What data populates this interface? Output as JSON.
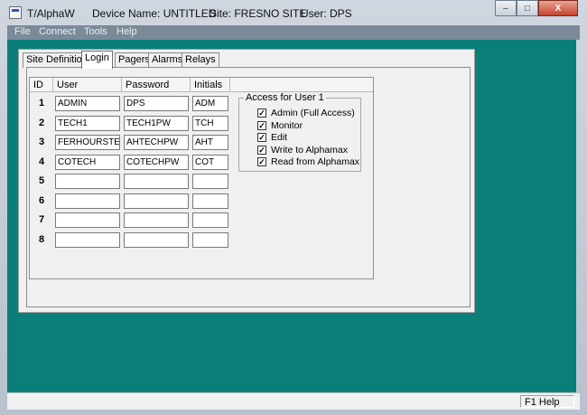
{
  "titlebar": {
    "app": "T/AlphaW",
    "device": "Device Name: UNTITLED",
    "site": "Site: FRESNO SITE",
    "user": "User: DPS",
    "controls": {
      "minimize": "–",
      "maximize": "□",
      "close": "X"
    }
  },
  "menu": [
    "File",
    "Connect",
    "Tools",
    "Help"
  ],
  "tabs": [
    "Site Definition",
    "Login",
    "Pagers",
    "Alarms",
    "Relays"
  ],
  "active_tab": "Login",
  "grid": {
    "headers": [
      "ID",
      "User",
      "Password",
      "Initials"
    ],
    "rows": [
      {
        "id": "1",
        "user": "ADMIN",
        "password": "DPS",
        "initials": "ADM"
      },
      {
        "id": "2",
        "user": "TECH1",
        "password": "TECH1PW",
        "initials": "TCH"
      },
      {
        "id": "3",
        "user": "FERHOURSTEC",
        "password": "AHTECHPW",
        "initials": "AHT"
      },
      {
        "id": "4",
        "user": "COTECH",
        "password": "COTECHPW",
        "initials": "COT"
      },
      {
        "id": "5",
        "user": "",
        "password": "",
        "initials": ""
      },
      {
        "id": "6",
        "user": "",
        "password": "",
        "initials": ""
      },
      {
        "id": "7",
        "user": "",
        "password": "",
        "initials": ""
      },
      {
        "id": "8",
        "user": "",
        "password": "",
        "initials": ""
      }
    ]
  },
  "access": {
    "title": "Access for User 1",
    "permissions": [
      {
        "label": "Admin (Full Access)",
        "checked": true
      },
      {
        "label": "Monitor",
        "checked": true
      },
      {
        "label": "Edit",
        "checked": true
      },
      {
        "label": "Write to Alphamax",
        "checked": true
      },
      {
        "label": "Read from Alphamax",
        "checked": true
      }
    ]
  },
  "status": {
    "help": "F1  Help"
  },
  "colors": {
    "client_background": "#0a7f7a",
    "menubar": "#7b8a99"
  }
}
